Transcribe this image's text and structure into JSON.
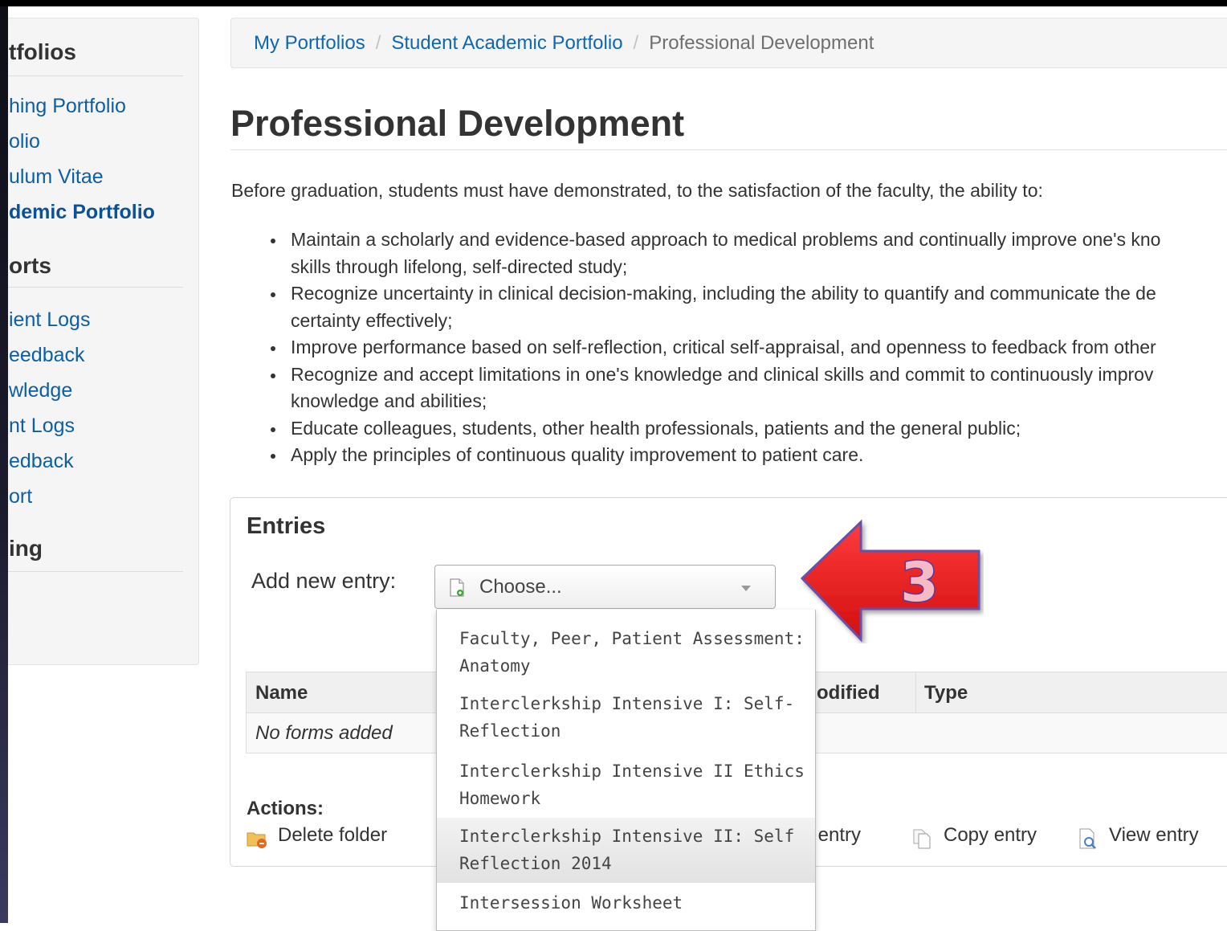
{
  "sidebar": {
    "sections": [
      {
        "header": "tfolios",
        "items": [
          {
            "label": "hing Portfolio",
            "active": false
          },
          {
            "label": "olio",
            "active": false
          },
          {
            "label": "ulum Vitae",
            "active": false
          },
          {
            "label": "demic Portfolio",
            "active": true
          }
        ]
      },
      {
        "header": "orts",
        "items": [
          {
            "label": "ient Logs"
          },
          {
            "label": "eedback"
          },
          {
            "label": "wledge"
          },
          {
            "label": "nt Logs"
          },
          {
            "label": "edback"
          },
          {
            "label": "ort"
          }
        ]
      },
      {
        "header": "ing",
        "items": []
      }
    ]
  },
  "breadcrumb": {
    "items": [
      "My Portfolios",
      "Student Academic Portfolio"
    ],
    "separator": "/",
    "current": "Professional Development"
  },
  "page": {
    "title": "Professional Development",
    "intro": "Before graduation, students must have demonstrated, to the satisfaction of the faculty, the ability to:",
    "bullets": [
      [
        "Maintain a scholarly and evidence-based approach to medical problems and continually improve one's kno",
        "skills through lifelong, self-directed study;"
      ],
      [
        "Recognize uncertainty in clinical decision-making, including the ability to quantify and communicate the de",
        "certainty effectively;"
      ],
      [
        "Improve performance based on self-reflection, critical self-appraisal, and openness to feedback from other"
      ],
      [
        "Recognize and accept limitations in one's knowledge and clinical skills and commit to continuously improv",
        "knowledge and abilities;"
      ],
      [
        "Educate colleagues, students, other health professionals, patients and the general public;"
      ],
      [
        "Apply the principles of continuous quality improvement to patient care."
      ]
    ]
  },
  "entries": {
    "title": "Entries",
    "add_label": "Add new entry:",
    "select": {
      "value": "Choose...",
      "icon": "new-document-icon"
    },
    "table": {
      "headers": [
        "Name",
        "odified",
        "Type"
      ],
      "empty_text": "No forms added"
    },
    "actions_label": "Actions:",
    "actions": [
      {
        "label": "Delete folder",
        "icon": "delete-folder-icon"
      },
      {
        "label": "it entry",
        "icon": "edit-entry-icon"
      },
      {
        "label": "Copy entry",
        "icon": "copy-entry-icon"
      },
      {
        "label": "View entry",
        "icon": "view-entry-icon"
      }
    ]
  },
  "dropdown": {
    "options": [
      {
        "lines": [
          "Faculty, Peer, Patient Assessment:",
          "Anatomy"
        ],
        "highlighted": false
      },
      {
        "lines": [
          "Interclerkship Intensive I: Self-",
          "Reflection"
        ],
        "highlighted": false
      },
      {
        "lines": [
          "Interclerkship Intensive II Ethics",
          "Homework"
        ],
        "highlighted": false
      },
      {
        "lines": [
          "Interclerkship Intensive II: Self",
          "Reflection 2014"
        ],
        "highlighted": true
      },
      {
        "lines": [
          "Intersession Worksheet"
        ],
        "highlighted": false
      }
    ]
  },
  "callout": {
    "number": "3",
    "arrow_color": "#ee1c1c",
    "outline_color": "#6b4fa8"
  },
  "colors": {
    "link": "#0e67b2",
    "sidebar_bg": "#f5f5f5",
    "text": "#333333"
  }
}
